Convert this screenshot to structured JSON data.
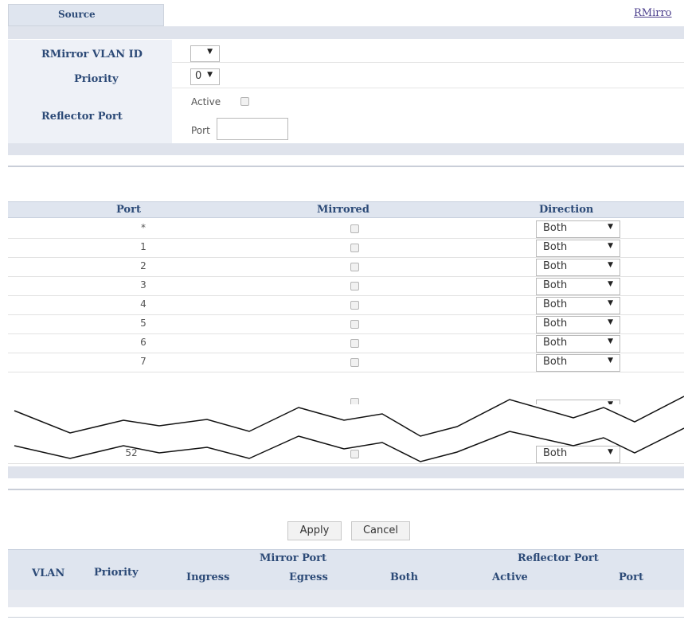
{
  "header": {
    "tab_source": "Source",
    "tab_rmirror": "RMirro"
  },
  "settings": {
    "vlan_label": "RMirror VLAN ID",
    "vlan_value": "",
    "priority_label": "Priority",
    "priority_value": "0",
    "reflector_label": "Reflector Port",
    "active_label": "Active",
    "port_label": "Port",
    "port_value": ""
  },
  "port_table": {
    "headers": {
      "port": "Port",
      "mirrored": "Mirrored",
      "direction": "Direction"
    },
    "rows": [
      {
        "port": "*",
        "direction": "Both"
      },
      {
        "port": "1",
        "direction": "Both"
      },
      {
        "port": "2",
        "direction": "Both"
      },
      {
        "port": "3",
        "direction": "Both"
      },
      {
        "port": "4",
        "direction": "Both"
      },
      {
        "port": "5",
        "direction": "Both"
      },
      {
        "port": "6",
        "direction": "Both"
      },
      {
        "port": "7",
        "direction": "Both"
      }
    ],
    "last_row": {
      "port": "52",
      "direction": "Both"
    }
  },
  "buttons": {
    "apply": "Apply",
    "cancel": "Cancel"
  },
  "summary": {
    "vlan": "VLAN",
    "priority": "Priority",
    "mirror_port": "Mirror Port",
    "ingress": "Ingress",
    "egress": "Egress",
    "both": "Both",
    "reflector_port": "Reflector Port",
    "active": "Active",
    "port": "Port"
  }
}
